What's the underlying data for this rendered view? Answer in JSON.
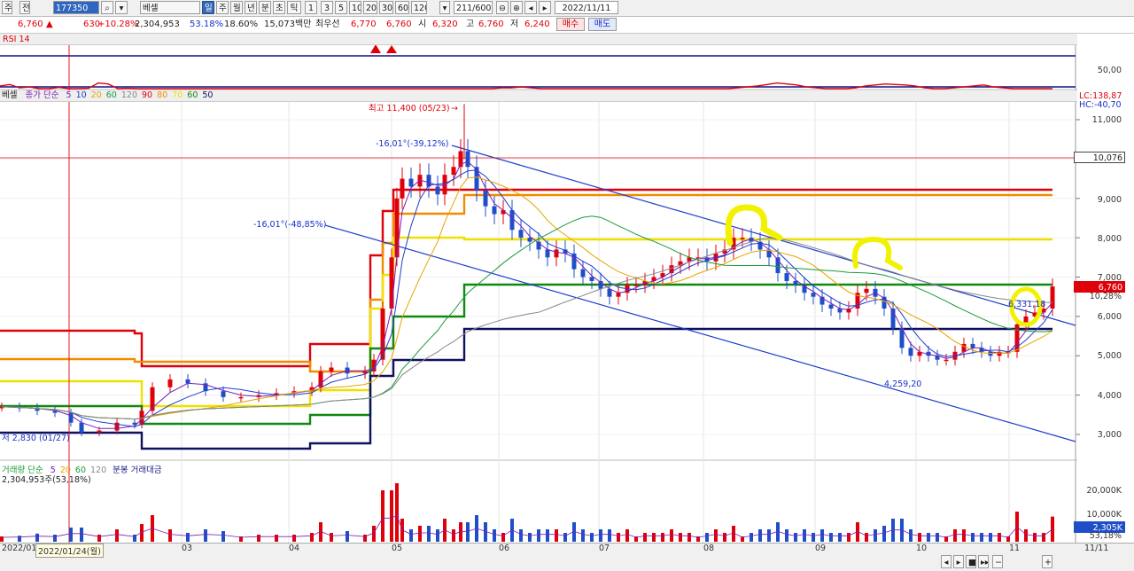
{
  "toolbar": {
    "market": "주",
    "period_sel": "전",
    "code": "177350",
    "stock_name": "베셀",
    "btn_day": "일",
    "btn_week": "주",
    "btn_month": "월",
    "btn_year": "년",
    "btn_min": "분",
    "btn_sec": "초",
    "btn_tick": "틱",
    "intervals": [
      "1",
      "3",
      "5",
      "10",
      "20",
      "30",
      "60",
      "120"
    ],
    "count": "211",
    "count_total": "/600",
    "date": "2022/11/11"
  },
  "quote": {
    "price": "6,760",
    "arrow": "▲",
    "change": "630",
    "change_pct": "+10.28%",
    "volume": "2,304,953",
    "vol_ratio": "53.18%",
    "turnover": "18.60%",
    "amount": "15,073백만",
    "pref_label": "최우선",
    "best_ask": "6,770",
    "best_bid": "6,760",
    "open_label": "시",
    "open": "6,320",
    "high_label": "고",
    "high": "6,760",
    "low_label": "저",
    "low": "6,240",
    "buy_btn": "매수",
    "sell_btn": "매도"
  },
  "rsi": {
    "label": "RSI 14",
    "level_label": "50,00"
  },
  "price_legend": {
    "name": "베셀",
    "ma_label": "종가 단순",
    "ma_periods": [
      {
        "label": "5",
        "color": "#7a1fb5"
      },
      {
        "label": "10",
        "color": "#1f3fcc"
      },
      {
        "label": "20",
        "color": "#e8a400"
      },
      {
        "label": "60",
        "color": "#1a9a3a"
      },
      {
        "label": "120",
        "color": "#888888"
      },
      {
        "label": "90",
        "color": "#e0000a"
      },
      {
        "label": "80",
        "color": "#f08c00"
      },
      {
        "label": "70",
        "color": "#f0e000"
      },
      {
        "label": "60",
        "color": "#118811"
      },
      {
        "label": "50",
        "color": "#101060"
      }
    ]
  },
  "annotations": {
    "high": "최고 11,400 (05/23)",
    "low": "저 2,830 (01/27)",
    "trend_top": "-16,01°(-39,12%)",
    "trend_bottom": "-16,01°(-48,85%)",
    "trend_bottom_point": "4,259,20",
    "last_ma": "6,331,18",
    "lc": "LC:138,87",
    "hc": "HC:-40,70",
    "price_mark": "10,076",
    "current_price": "6,760",
    "current_pct": "10,28%"
  },
  "volume": {
    "legend_label": "거래량 단순",
    "periods": [
      {
        "label": "5",
        "color": "#7a1fb5"
      },
      {
        "label": "20",
        "color": "#e8a400"
      },
      {
        "label": "60",
        "color": "#1a9a3a"
      },
      {
        "label": "120",
        "color": "#888888"
      }
    ],
    "legend_extra": "분봉 거래대금",
    "value_label": "2,304,953주(53,18%)",
    "cur_value": "2,305K",
    "cur_pct": "53,18%",
    "axis": [
      "20,000K",
      "10,000K"
    ]
  },
  "chart_data": {
    "type": "candlestick",
    "y_axis": [
      "11,000",
      "10,000",
      "9,000",
      "8,000",
      "7,000",
      "6,000",
      "5,000",
      "4,000",
      "3,000"
    ],
    "x_axis": [
      "2022/01",
      "2022/01/24(월)",
      "03",
      "04",
      "05",
      "06",
      "07",
      "08",
      "09",
      "10",
      "11",
      "11/11"
    ],
    "high": 11400,
    "low": 2830,
    "last_close": 6760,
    "levels": [
      {
        "name": "90",
        "value": 10200,
        "color": "#e0000a"
      },
      {
        "name": "80",
        "value": 9100,
        "color": "#f08c00"
      },
      {
        "name": "70",
        "value": 8000,
        "color": "#f0e000"
      },
      {
        "name": "60",
        "value": 6800,
        "color": "#118811"
      },
      {
        "name": "50",
        "value": 5700,
        "color": "#101060"
      }
    ]
  },
  "colors": {
    "up": "#e0000a",
    "down": "#1f4fc8",
    "rsi": "#e0000a",
    "rsi_band": "#10108a"
  }
}
